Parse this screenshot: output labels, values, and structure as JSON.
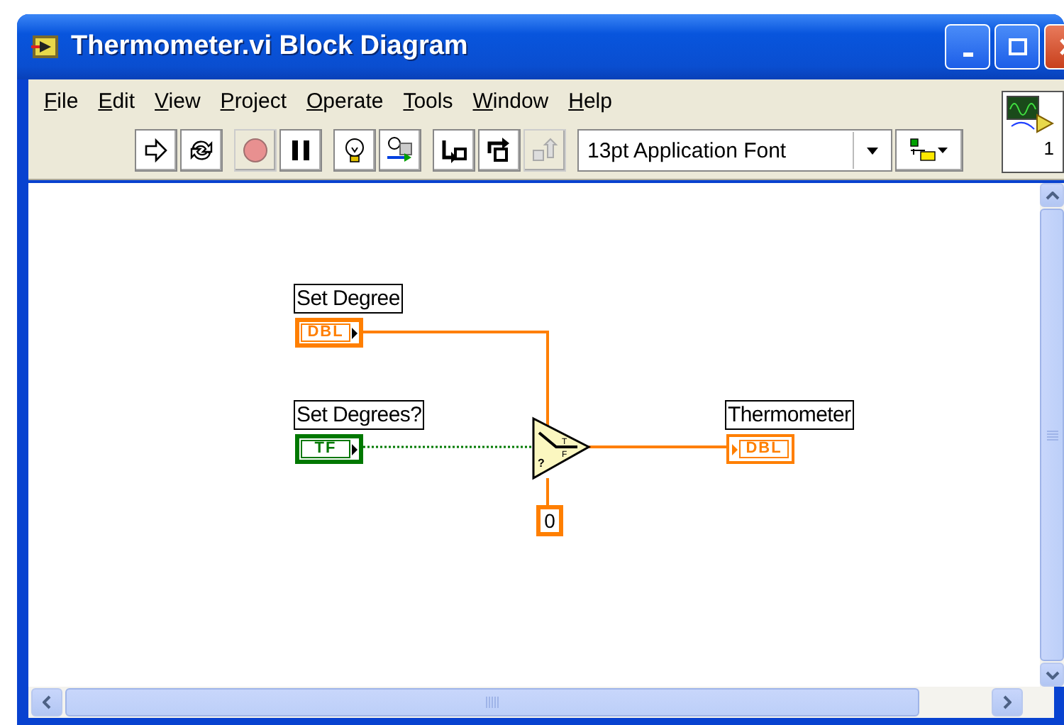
{
  "window": {
    "title": "Thermometer.vi Block Diagram"
  },
  "menu": [
    {
      "label": "File"
    },
    {
      "label": "Edit"
    },
    {
      "label": "View"
    },
    {
      "label": "Project"
    },
    {
      "label": "Operate"
    },
    {
      "label": "Tools"
    },
    {
      "label": "Window"
    },
    {
      "label": "Help"
    }
  ],
  "toolbar": [
    {
      "kind": "run",
      "disabled": false
    },
    {
      "kind": "run-continuously",
      "disabled": false
    },
    {
      "kind": "abort",
      "disabled": true
    },
    {
      "kind": "pause",
      "disabled": false
    },
    {
      "kind": "highlight",
      "disabled": false
    },
    {
      "kind": "retain",
      "disabled": false
    },
    {
      "kind": "step-into",
      "disabled": false
    },
    {
      "kind": "step-over",
      "disabled": false
    },
    {
      "kind": "step-out",
      "disabled": true
    }
  ],
  "font_dropdown": {
    "value": "13pt Application Font"
  },
  "vi_icon": {
    "number": "1"
  },
  "diagram": {
    "terminals": [
      {
        "label": "Set Degree",
        "kind": "control",
        "color": "#ff7f00",
        "text": "DBL"
      },
      {
        "label": "Set Degrees?",
        "kind": "control",
        "color": "#007800",
        "text": "TF"
      },
      {
        "label": "Thermometer",
        "kind": "indicator",
        "color": "#ff7f00",
        "text": "DBL"
      }
    ],
    "select": {
      "selector": "?",
      "true_mark": "T",
      "false_mark": "F"
    },
    "constant": {
      "value": "0"
    }
  }
}
